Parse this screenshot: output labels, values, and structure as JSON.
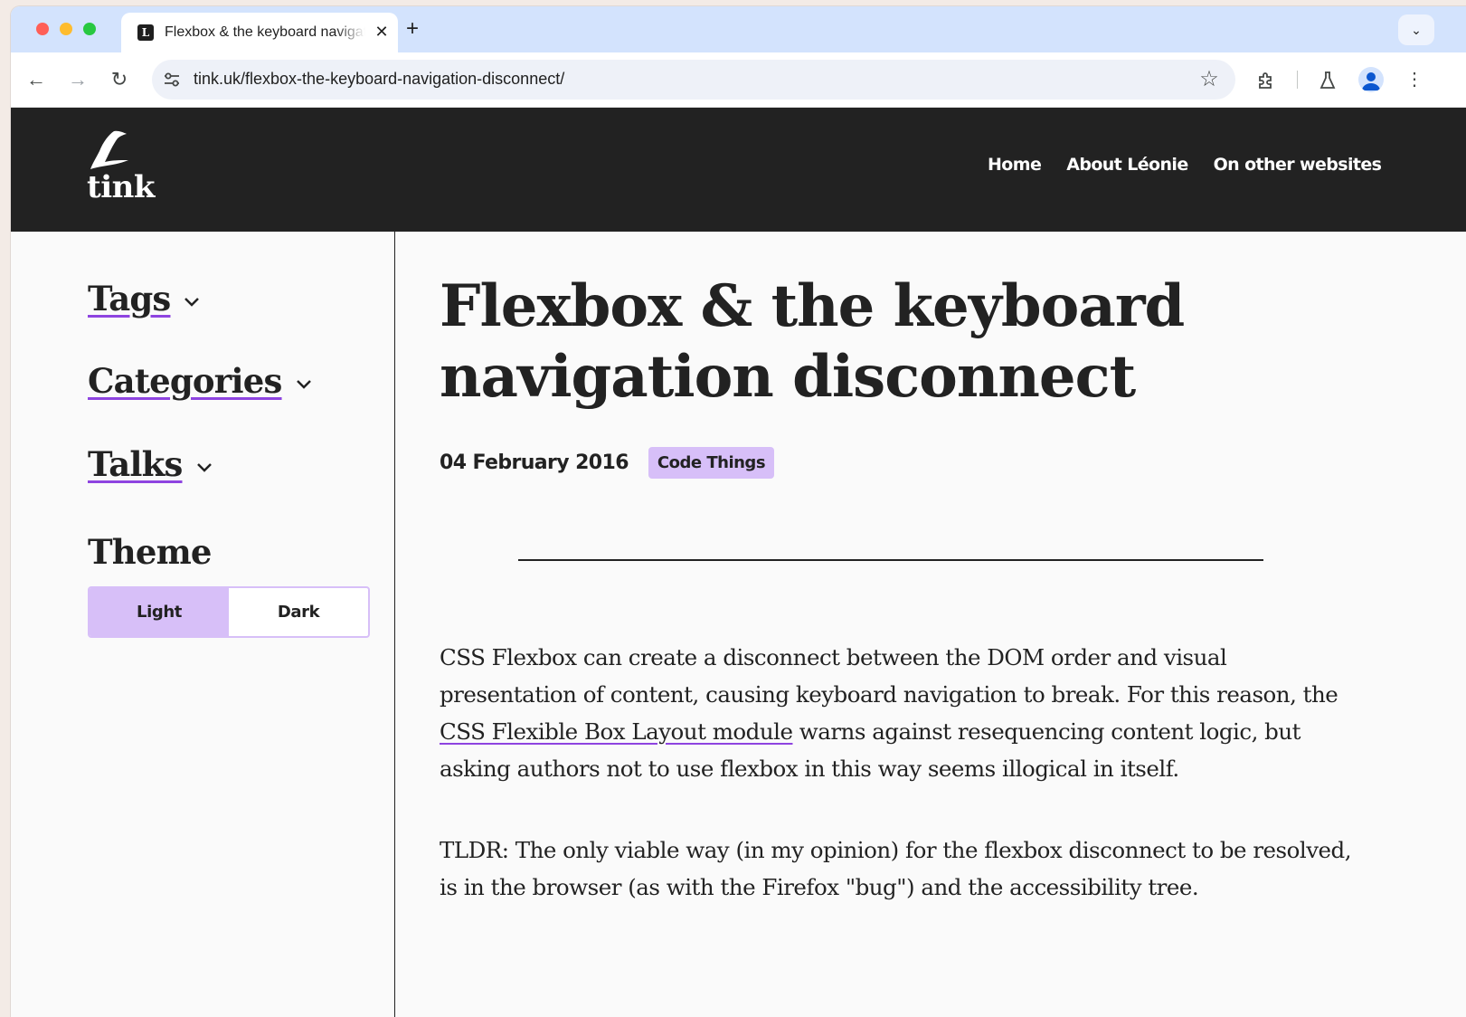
{
  "browser": {
    "tab_title": "Flexbox & the keyboard navigation disconnect",
    "url": "tink.uk/flexbox-the-keyboard-navigation-disconnect/"
  },
  "site": {
    "logo_text": "tink",
    "nav": [
      "Home",
      "About Léonie",
      "On other websites"
    ]
  },
  "sidebar": {
    "tags": "Tags",
    "categories": "Categories",
    "talks": "Talks",
    "theme_heading": "Theme",
    "theme_light": "Light",
    "theme_dark": "Dark"
  },
  "article": {
    "title": "Flexbox & the keyboard navigation disconnect",
    "date": "04 February 2016",
    "tag": "Code Things",
    "para1_before": "CSS Flexbox can create a disconnect between the DOM order and visual presentation of content, causing keyboard navigation to break. For this reason, the ",
    "para1_link": "CSS Flexible Box Layout module",
    "para1_after": " warns against resequencing content logic, but asking authors not to use flexbox in this way seems illogical in itself.",
    "para2": "TLDR: The only viable way (in my opinion) for the flexbox disconnect to be resolved, is in the browser (as with the Firefox \"bug\") and the accessibility tree."
  },
  "colors": {
    "accent": "#d7bff8",
    "link_underline": "#8e44e0",
    "header_bg": "#222222",
    "tabstrip_bg": "#d3e3fd"
  },
  "icons": [
    "site-info-icon",
    "bookmark-star-icon",
    "extensions-icon",
    "labs-icon",
    "profile-icon",
    "menu-icon",
    "chevron-down-icon"
  ]
}
